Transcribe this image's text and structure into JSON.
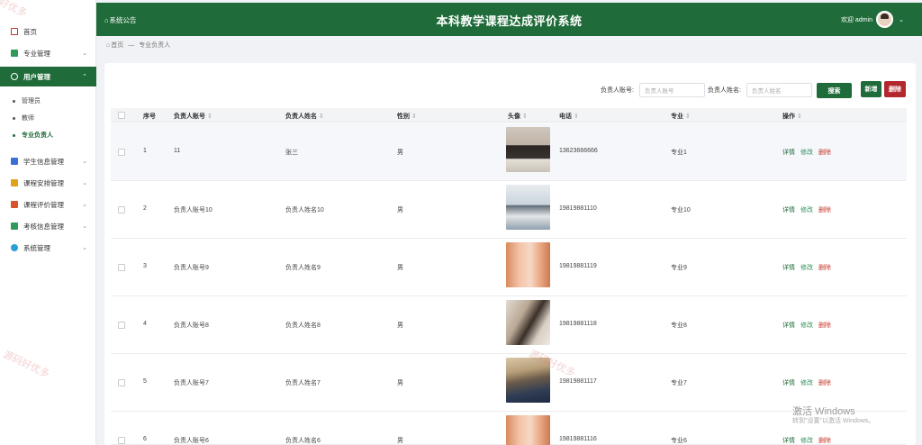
{
  "header": {
    "notice": "系统公告",
    "title": "本科教学课程达成评价系统",
    "welcome": "欢迎 admin"
  },
  "breadcrumb": {
    "home": "首页",
    "sep": "—",
    "current": "专业负责人"
  },
  "sidebar": {
    "items": [
      {
        "label": "首页"
      },
      {
        "label": "专业管理"
      },
      {
        "label": "用户管理"
      },
      {
        "label": "学生信息管理"
      },
      {
        "label": "课程安排管理"
      },
      {
        "label": "课程评价管理"
      },
      {
        "label": "考核信息管理"
      },
      {
        "label": "系统管理"
      }
    ],
    "sub": [
      {
        "label": "管理员"
      },
      {
        "label": "教师"
      },
      {
        "label": "专业负责人"
      }
    ]
  },
  "search": {
    "account_label": "负责人账号:",
    "account_placeholder": "负责人账号",
    "name_label": "负责人姓名:",
    "name_placeholder": "负责人姓名",
    "search_btn": "搜索",
    "add_btn": "新增",
    "delete_btn": "删除"
  },
  "table": {
    "headers": [
      "序号",
      "负责人账号",
      "负责人姓名",
      "性别",
      "头像",
      "电话",
      "专业",
      "操作"
    ],
    "sort_icon": "⇕",
    "actions": {
      "detail": "详情",
      "edit": "修改",
      "delete": "删除"
    },
    "rows": [
      {
        "no": "1",
        "account": "11",
        "name": "张三",
        "gender": "男",
        "phone": "13623666666",
        "major": "专业1"
      },
      {
        "no": "2",
        "account": "负责人账号10",
        "name": "负责人姓名10",
        "gender": "男",
        "phone": "19819881110",
        "major": "专业10"
      },
      {
        "no": "3",
        "account": "负责人账号9",
        "name": "负责人姓名9",
        "gender": "男",
        "phone": "19819881119",
        "major": "专业9"
      },
      {
        "no": "4",
        "account": "负责人账号8",
        "name": "负责人姓名8",
        "gender": "男",
        "phone": "19819881118",
        "major": "专业8"
      },
      {
        "no": "5",
        "account": "负责人账号7",
        "name": "负责人姓名7",
        "gender": "男",
        "phone": "19819881117",
        "major": "专业7"
      },
      {
        "no": "6",
        "account": "负责人账号6",
        "name": "负责人姓名6",
        "gender": "男",
        "phone": "19819881116",
        "major": "专业6"
      }
    ]
  },
  "watermark": {
    "text1": "源码好优多",
    "text2": "源码好优多",
    "text3": "好优多"
  },
  "windows": {
    "line1": "激活 Windows",
    "line2": "转到\"设置\"以激活 Windows。"
  },
  "colors": {
    "primary": "#1f6b3a",
    "danger": "#b3282d"
  }
}
